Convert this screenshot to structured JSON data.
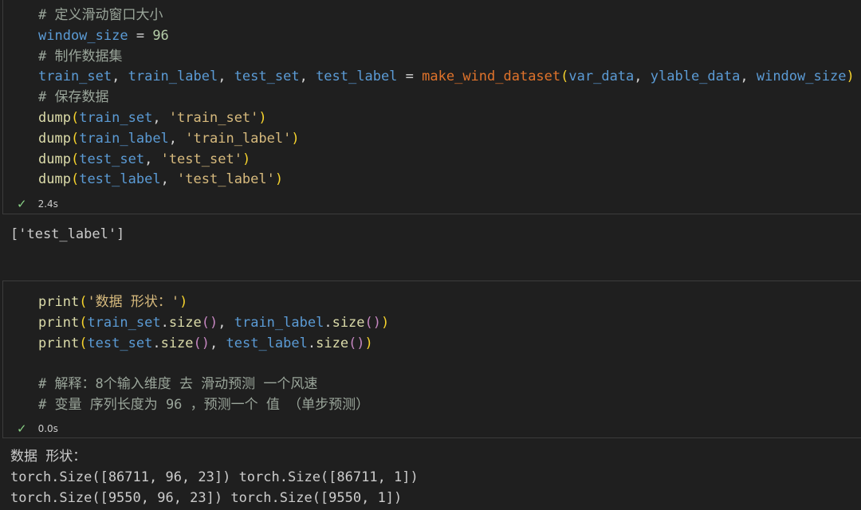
{
  "cell1": {
    "lines": [
      "# 定义滑动窗口大小",
      "window_size = 96",
      "# 制作数据集",
      "train_set, train_label, test_set, test_label = make_wind_dataset(var_data, ylable_data, window_size)",
      "# 保存数据",
      "dump(train_set, 'train_set')",
      "dump(train_label, 'train_label')",
      "dump(test_set, 'test_set')",
      "dump(test_label, 'test_label')"
    ],
    "status_time": "2.4s",
    "output": "['test_label']"
  },
  "cell2": {
    "lines": [
      "print('数据 形状：')",
      "print(train_set.size(), train_label.size())",
      "print(test_set.size(), test_label.size())",
      "",
      "# 解释：8个输入维度 去 滑动预测 一个风速",
      "# 变量 序列长度为 96 ，预测一个 值 （单步预测）"
    ],
    "status_time": "0.0s",
    "output_lines": [
      "数据 形状：",
      "torch.Size([86711, 96, 23]) torch.Size([86711, 1])",
      "torch.Size([9550, 96, 23]) torch.Size([9550, 1])"
    ]
  },
  "colors": {
    "background": "#1f1f1f",
    "comment": "#9aa59a",
    "variable": "#5b9bd5",
    "number": "#b5cea8",
    "function": "#dcdcaa",
    "user_function": "#e0732b",
    "string": "#d7ba7d",
    "check": "#89d185"
  },
  "icons": {
    "status": "check-icon"
  }
}
